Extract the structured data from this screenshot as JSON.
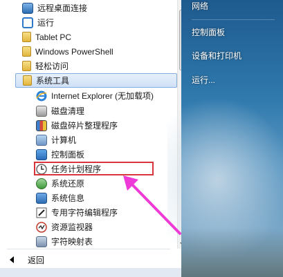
{
  "program_list": {
    "items": [
      {
        "label": "远程桌面连接",
        "icon": "remote-desktop-icon"
      },
      {
        "label": "运行",
        "icon": "run-icon"
      },
      {
        "label": "Tablet PC",
        "icon": "folder-icon"
      },
      {
        "label": "Windows PowerShell",
        "icon": "folder-icon"
      },
      {
        "label": "轻松访问",
        "icon": "folder-icon"
      },
      {
        "label": "系统工具",
        "icon": "folder-icon"
      },
      {
        "label": "Internet Explorer (无加载项)",
        "icon": "internet-explorer-icon"
      },
      {
        "label": "磁盘清理",
        "icon": "disk-cleanup-icon"
      },
      {
        "label": "磁盘碎片整理程序",
        "icon": "disk-defragmenter-icon"
      },
      {
        "label": "计算机",
        "icon": "computer-icon"
      },
      {
        "label": "控制面板",
        "icon": "control-panel-icon"
      },
      {
        "label": "任务计划程序",
        "icon": "task-scheduler-icon"
      },
      {
        "label": "系统还原",
        "icon": "system-restore-icon"
      },
      {
        "label": "系统信息",
        "icon": "system-info-icon"
      },
      {
        "label": "专用字符编辑程序",
        "icon": "private-character-editor-icon"
      },
      {
        "label": "资源监视器",
        "icon": "resource-monitor-icon"
      },
      {
        "label": "字符映射表",
        "icon": "character-map-icon"
      }
    ],
    "selected_label": "系统工具",
    "highlighted_label": "任务计划程序"
  },
  "back": {
    "label": "返回",
    "icon": "back-arrow-icon"
  },
  "right_pane": {
    "links": [
      "网络",
      "控制面板",
      "设备和打印机",
      "运行..."
    ]
  },
  "colors": {
    "highlight_border": "#d9343a",
    "arrow": "#ee3ad6",
    "selected_bg": "#d6e5f8"
  }
}
